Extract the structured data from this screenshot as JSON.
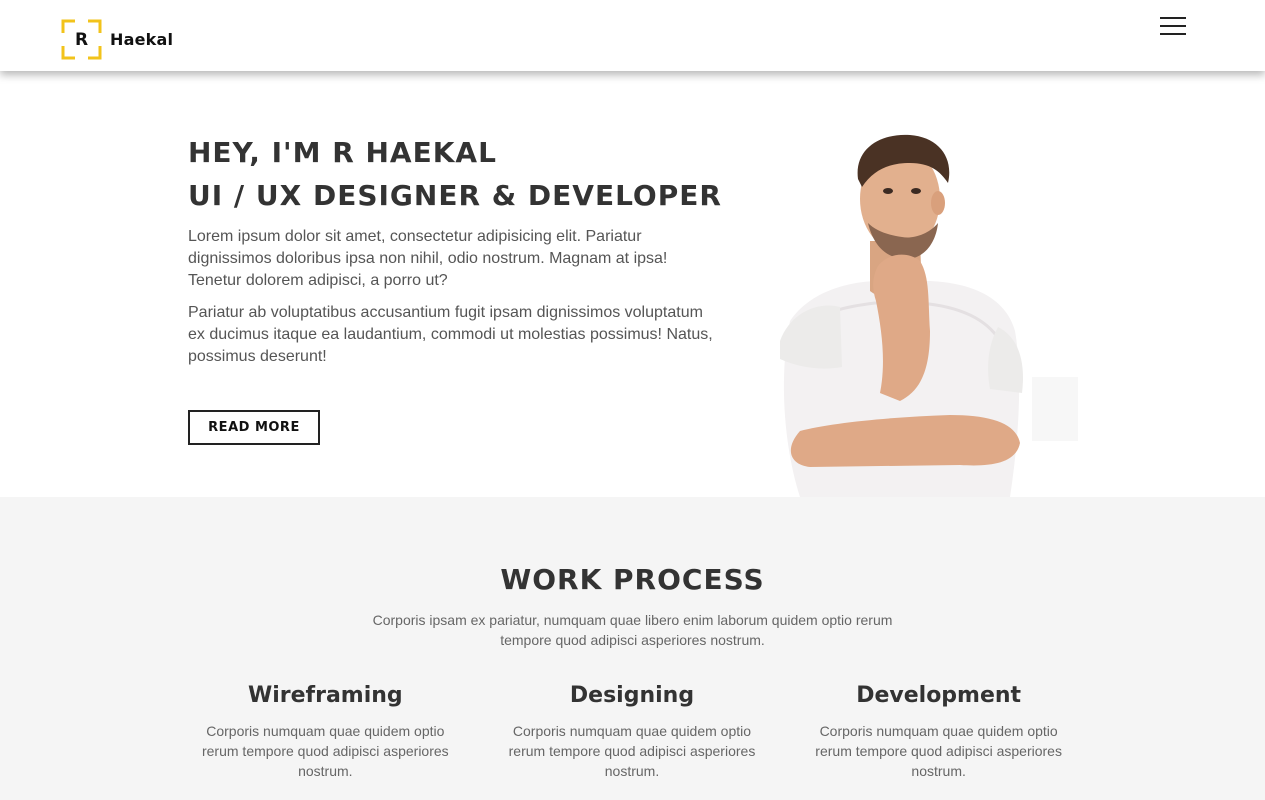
{
  "brand": {
    "letter": "R",
    "name": "Haekal",
    "accent_color": "#f2c31b"
  },
  "nav": {
    "menu_icon": "hamburger-icon"
  },
  "hero": {
    "title_line1": "HEY, I'M R HAEKAL",
    "title_line2": "UI / UX DESIGNER & DEVELOPER",
    "paragraph1": "Lorem ipsum dolor sit amet, consectetur adipisicing elit. Pariatur dignissimos doloribus ipsa non nihil, odio nostrum. Magnam at ipsa! Tenetur dolorem adipisci, a porro ut?",
    "paragraph2": "Pariatur ab voluptatibus accusantium fugit ipsam dignissimos voluptatum ex ducimus itaque ea laudantium, commodi ut molestias possimus! Natus, possimus deserunt!",
    "button_label": "READ MORE"
  },
  "work_process": {
    "title": "WORK PROCESS",
    "subtitle": "Corporis ipsam ex pariatur, numquam quae libero enim laborum quidem optio rerum tempore quod adipisci asperiores nostrum.",
    "steps": [
      {
        "title": "Wireframing",
        "description": "Corporis numquam quae quidem optio rerum tempore quod adipisci asperiores nostrum."
      },
      {
        "title": "Designing",
        "description": "Corporis numquam quae quidem optio rerum tempore quod adipisci asperiores nostrum."
      },
      {
        "title": "Development",
        "description": "Corporis numquam quae quidem optio rerum tempore quod adipisci asperiores nostrum."
      }
    ]
  }
}
